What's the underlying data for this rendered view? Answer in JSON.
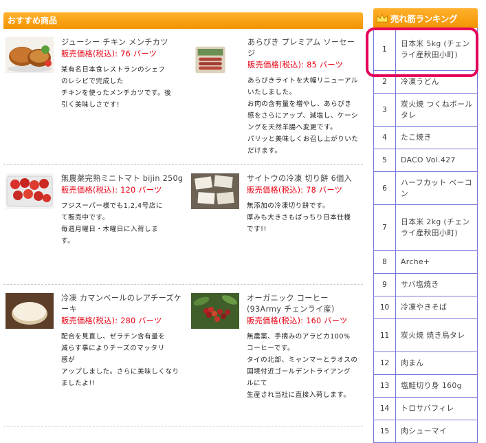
{
  "section": {
    "title": "おすすめ商品"
  },
  "price_label": "販売価格(税込):",
  "products": [
    {
      "name": "ジューシー チキン メンチカツ",
      "price": "76 バーツ",
      "desc": "某有名日本食レストランのシェフ\nのレシピで完成した\nチキンを使ったメンチカツです。後\n引く美味しさです!"
    },
    {
      "name": "あらびき プレミアム ソーセージ",
      "price": "85 バーツ",
      "desc": "あらびきライトを大幅リニューアル\nいたしました。\nお肉の含有量を増やし、あらびき\n感をさらにアップ、減塩し、ケーシ\nングを天然羊腸へ変更です。\nパリッと美味しくお召し上がりいた\nだけます。"
    },
    {
      "name": "無農薬完熟ミニトマト bijin 250g",
      "price": "120 バーツ",
      "desc": "フジスーパー様でも1,2,4号店に\nて販売中です。\n毎週月曜日・木曜日に入荷しま\nす。"
    },
    {
      "name": "サイトウの冷凍 切り餅 6個入",
      "price": "78 バーツ",
      "desc": "無添加の冷凍切り餅です。\n厚みも大きさもばっちり日本仕様\nです!!"
    },
    {
      "name": "冷凍 カマンベールのレアチーズケーキ",
      "price": "280 バーツ",
      "desc": "配合を見直し、ゼラチン含有量を\n減らす事によりチーズのマッタリ\n感が\nアップしました。さらに美味しくなり\nましたよ!!"
    },
    {
      "name": "オーガニック コーヒー (93Army チェンライ産)",
      "price": "160 バーツ",
      "desc": "無農薬、手摘みのアラビカ100%\nコーヒーです。\nタイの北部、ミャンマーとラオスの\n国境付近ゴールデントライアング\nルにて\n生産され当社に直接入荷します。"
    }
  ],
  "ranking": {
    "title": "売れ筋ランキング",
    "items": [
      {
        "rank": "1",
        "name": "日本米 5kg (チェンライ産秋田小町)"
      },
      {
        "rank": "2",
        "name": "冷凍うどん"
      },
      {
        "rank": "3",
        "name": "炭火焼 つくねボールタレ"
      },
      {
        "rank": "4",
        "name": "たこ焼き"
      },
      {
        "rank": "5",
        "name": "DACO Vol.427"
      },
      {
        "rank": "6",
        "name": "ハーフカット ベーコン"
      },
      {
        "rank": "7",
        "name": "日本米 2kg (チェンライ産秋田小町)"
      },
      {
        "rank": "8",
        "name": "Arche+"
      },
      {
        "rank": "9",
        "name": "サバ塩焼き"
      },
      {
        "rank": "10",
        "name": "冷凍やきそば"
      },
      {
        "rank": "11",
        "name": "炭火焼 焼き鳥タレ"
      },
      {
        "rank": "12",
        "name": "肉まん"
      },
      {
        "rank": "13",
        "name": "塩鮭切り身 160g"
      },
      {
        "rank": "14",
        "name": "トロサバフィレ"
      },
      {
        "rank": "15",
        "name": "肉シューマイ"
      }
    ]
  },
  "colors": {
    "accent": "#f39400",
    "price": "#e60012",
    "rank_border": "#7777dd",
    "highlight": "#e4005a"
  }
}
